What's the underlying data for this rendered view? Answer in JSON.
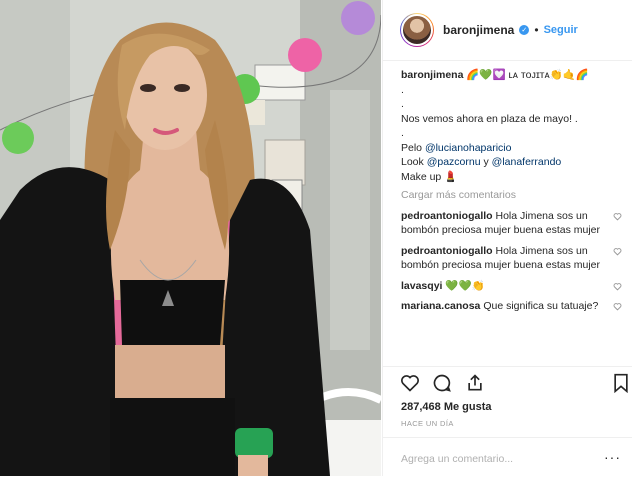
{
  "header": {
    "username": "baronjimena",
    "separator": "•",
    "follow_label": "Seguir"
  },
  "caption": {
    "username": "baronjimena",
    "text": "🌈💚💟 ʟᴀ ᴛᴏᴊɪᴛᴀ👏🤙🌈",
    "dot1": ".",
    "dot2": ".",
    "line": "Nos vemos ahora en plaza de mayo! .",
    "dot3": ".",
    "pelo_label": "Pelo",
    "pelo_mention": "@lucianohaparicio",
    "look_label": "Look",
    "look_mention1": "@pazcornu",
    "look_y": "y",
    "look_mention2": "@lanaferrando",
    "makeup": "Make up 💄"
  },
  "load_more": "Cargar más comentarios",
  "comments": [
    {
      "user": "pedroantoniogallo",
      "text": "Hola Jimena sos un bombón preciosa mujer buena estas mujer"
    },
    {
      "user": "pedroantoniogallo",
      "text": "Hola Jimena sos un bombón preciosa mujer buena estas mujer"
    },
    {
      "user": "lavasqyi",
      "text": "💚💚👏"
    },
    {
      "user": "mariana.canosa",
      "text": "Que significa su tatuaje?"
    }
  ],
  "likes": "287,468 Me gusta",
  "time_ago": "HACE UN DÍA",
  "comment_placeholder": "Agrega un comentario...",
  "more_dots": "···",
  "icons": [
    "heart-icon",
    "comment-icon",
    "share-icon",
    "bookmark-icon",
    "verified-icon"
  ],
  "colors": {
    "accent": "#3897f0",
    "text": "#262626",
    "muted": "#999999"
  }
}
